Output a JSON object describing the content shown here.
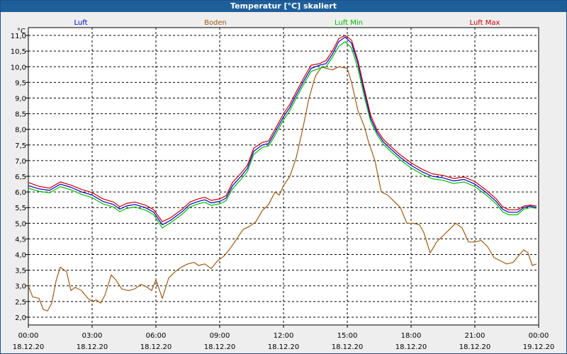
{
  "window": {
    "title": "Temperatur [°C] skaliert"
  },
  "chart_data": {
    "type": "line",
    "title": "Temperatur [°C] skaliert",
    "ylabel": "°C",
    "xlabel": "",
    "ylim": [
      1.75,
      11.25
    ],
    "xlim_hours": [
      0,
      24
    ],
    "grid": true,
    "legend_position": "top",
    "x_ticks": [
      {
        "h": 0,
        "time": "00:00",
        "date": "18.12.20"
      },
      {
        "h": 3,
        "time": "03:00",
        "date": "18.12.20"
      },
      {
        "h": 6,
        "time": "06:00",
        "date": "18.12.20"
      },
      {
        "h": 9,
        "time": "09:00",
        "date": "18.12.20"
      },
      {
        "h": 12,
        "time": "12:00",
        "date": "18.12.20"
      },
      {
        "h": 15,
        "time": "15:00",
        "date": "18.12.20"
      },
      {
        "h": 18,
        "time": "18:00",
        "date": "18.12.20"
      },
      {
        "h": 21,
        "time": "21:00",
        "date": "18.12.20"
      },
      {
        "h": 24,
        "time": "00:00",
        "date": "19.12.20"
      }
    ],
    "y_ticks": [
      "2,0",
      "2,5",
      "3,0",
      "3,5",
      "4,0",
      "4,5",
      "5,0",
      "5,5",
      "6,0",
      "6,5",
      "7,0",
      "7,5",
      "8,0",
      "8,5",
      "9,0",
      "9,5",
      "10,0",
      "10,5",
      "11,0"
    ],
    "series": [
      {
        "name": "Luft",
        "color": "#0000cc",
        "points": [
          [
            0,
            6.2
          ],
          [
            0.5,
            6.1
          ],
          [
            1,
            6.05
          ],
          [
            1.5,
            6.25
          ],
          [
            2,
            6.15
          ],
          [
            2.5,
            6.0
          ],
          [
            3,
            5.9
          ],
          [
            3.5,
            5.7
          ],
          [
            4,
            5.6
          ],
          [
            4.3,
            5.45
          ],
          [
            4.6,
            5.55
          ],
          [
            5,
            5.6
          ],
          [
            5.5,
            5.5
          ],
          [
            5.9,
            5.35
          ],
          [
            6.3,
            4.95
          ],
          [
            6.7,
            5.1
          ],
          [
            7.2,
            5.35
          ],
          [
            7.6,
            5.6
          ],
          [
            8,
            5.7
          ],
          [
            8.3,
            5.75
          ],
          [
            8.6,
            5.65
          ],
          [
            9,
            5.7
          ],
          [
            9.3,
            5.8
          ],
          [
            9.6,
            6.2
          ],
          [
            10,
            6.5
          ],
          [
            10.3,
            6.75
          ],
          [
            10.6,
            7.3
          ],
          [
            11,
            7.5
          ],
          [
            11.3,
            7.55
          ],
          [
            11.6,
            7.9
          ],
          [
            12,
            8.4
          ],
          [
            12.3,
            8.7
          ],
          [
            12.6,
            9.1
          ],
          [
            13,
            9.6
          ],
          [
            13.3,
            9.95
          ],
          [
            13.7,
            10.05
          ],
          [
            14,
            10.1
          ],
          [
            14.3,
            10.4
          ],
          [
            14.6,
            10.8
          ],
          [
            14.9,
            10.95
          ],
          [
            15.2,
            10.75
          ],
          [
            15.5,
            10.1
          ],
          [
            15.8,
            9.2
          ],
          [
            16.1,
            8.35
          ],
          [
            16.4,
            7.9
          ],
          [
            16.7,
            7.6
          ],
          [
            17,
            7.4
          ],
          [
            17.5,
            7.1
          ],
          [
            18,
            6.85
          ],
          [
            18.5,
            6.65
          ],
          [
            19,
            6.5
          ],
          [
            19.5,
            6.45
          ],
          [
            20,
            6.35
          ],
          [
            20.5,
            6.4
          ],
          [
            21,
            6.25
          ],
          [
            21.5,
            6.0
          ],
          [
            22,
            5.7
          ],
          [
            22.3,
            5.45
          ],
          [
            22.6,
            5.35
          ],
          [
            23,
            5.35
          ],
          [
            23.3,
            5.5
          ],
          [
            23.6,
            5.55
          ],
          [
            23.9,
            5.5
          ]
        ]
      },
      {
        "name": "Boden",
        "color": "#a05a14",
        "points": [
          [
            0,
            3.0
          ],
          [
            0.2,
            2.65
          ],
          [
            0.5,
            2.6
          ],
          [
            0.7,
            2.25
          ],
          [
            0.9,
            2.2
          ],
          [
            1.1,
            2.45
          ],
          [
            1.3,
            3.15
          ],
          [
            1.5,
            3.6
          ],
          [
            1.8,
            3.45
          ],
          [
            2.0,
            2.85
          ],
          [
            2.2,
            2.95
          ],
          [
            2.5,
            2.85
          ],
          [
            2.8,
            2.6
          ],
          [
            3.0,
            2.5
          ],
          [
            3.2,
            2.55
          ],
          [
            3.4,
            2.45
          ],
          [
            3.6,
            2.7
          ],
          [
            3.9,
            3.35
          ],
          [
            4.1,
            3.2
          ],
          [
            4.4,
            2.9
          ],
          [
            4.7,
            2.85
          ],
          [
            5.0,
            2.9
          ],
          [
            5.3,
            3.05
          ],
          [
            5.6,
            2.95
          ],
          [
            5.8,
            2.85
          ],
          [
            6.0,
            3.2
          ],
          [
            6.3,
            2.6
          ],
          [
            6.6,
            3.25
          ],
          [
            6.9,
            3.45
          ],
          [
            7.2,
            3.6
          ],
          [
            7.5,
            3.7
          ],
          [
            7.8,
            3.75
          ],
          [
            8.0,
            3.65
          ],
          [
            8.3,
            3.7
          ],
          [
            8.6,
            3.55
          ],
          [
            8.9,
            3.8
          ],
          [
            9.2,
            3.95
          ],
          [
            9.5,
            4.2
          ],
          [
            9.8,
            4.5
          ],
          [
            10.1,
            4.8
          ],
          [
            10.4,
            4.9
          ],
          [
            10.7,
            5.05
          ],
          [
            11.0,
            5.4
          ],
          [
            11.3,
            5.6
          ],
          [
            11.6,
            6.0
          ],
          [
            11.8,
            5.9
          ],
          [
            12.0,
            6.2
          ],
          [
            12.3,
            6.5
          ],
          [
            12.6,
            7.1
          ],
          [
            12.9,
            8.0
          ],
          [
            13.2,
            9.0
          ],
          [
            13.5,
            9.7
          ],
          [
            13.8,
            10.0
          ],
          [
            14.0,
            9.95
          ],
          [
            14.3,
            9.9
          ],
          [
            14.6,
            10.0
          ],
          [
            15.0,
            9.95
          ],
          [
            15.2,
            9.5
          ],
          [
            15.5,
            8.6
          ],
          [
            15.8,
            8.1
          ],
          [
            16.0,
            7.6
          ],
          [
            16.3,
            7.0
          ],
          [
            16.6,
            6.0
          ],
          [
            16.9,
            5.9
          ],
          [
            17.2,
            5.7
          ],
          [
            17.5,
            5.5
          ],
          [
            17.8,
            5.0
          ],
          [
            18.1,
            5.0
          ],
          [
            18.4,
            4.95
          ],
          [
            18.6,
            4.7
          ],
          [
            18.9,
            4.05
          ],
          [
            19.2,
            4.4
          ],
          [
            19.5,
            4.6
          ],
          [
            19.8,
            4.8
          ],
          [
            20.1,
            5.0
          ],
          [
            20.4,
            4.85
          ],
          [
            20.7,
            4.4
          ],
          [
            21.0,
            4.4
          ],
          [
            21.3,
            4.45
          ],
          [
            21.6,
            4.25
          ],
          [
            21.9,
            3.9
          ],
          [
            22.2,
            3.8
          ],
          [
            22.5,
            3.7
          ],
          [
            22.8,
            3.75
          ],
          [
            23.1,
            4.0
          ],
          [
            23.3,
            4.15
          ],
          [
            23.5,
            4.05
          ],
          [
            23.7,
            3.65
          ],
          [
            23.9,
            3.7
          ]
        ]
      },
      {
        "name": "Luft Min",
        "color": "#00bb00",
        "points": [
          [
            0,
            6.12
          ],
          [
            0.5,
            6.02
          ],
          [
            1,
            5.97
          ],
          [
            1.5,
            6.17
          ],
          [
            2,
            6.07
          ],
          [
            2.5,
            5.92
          ],
          [
            3,
            5.82
          ],
          [
            3.5,
            5.62
          ],
          [
            4,
            5.52
          ],
          [
            4.3,
            5.37
          ],
          [
            4.6,
            5.47
          ],
          [
            5,
            5.52
          ],
          [
            5.5,
            5.42
          ],
          [
            5.9,
            5.27
          ],
          [
            6.3,
            4.85
          ],
          [
            6.7,
            5.02
          ],
          [
            7.2,
            5.27
          ],
          [
            7.6,
            5.52
          ],
          [
            8,
            5.62
          ],
          [
            8.3,
            5.67
          ],
          [
            8.6,
            5.57
          ],
          [
            9,
            5.62
          ],
          [
            9.3,
            5.72
          ],
          [
            9.6,
            6.1
          ],
          [
            10,
            6.4
          ],
          [
            10.3,
            6.65
          ],
          [
            10.6,
            7.2
          ],
          [
            11,
            7.42
          ],
          [
            11.3,
            7.47
          ],
          [
            11.6,
            7.8
          ],
          [
            12,
            8.3
          ],
          [
            12.3,
            8.6
          ],
          [
            12.6,
            9.0
          ],
          [
            13,
            9.5
          ],
          [
            13.3,
            9.85
          ],
          [
            13.7,
            9.95
          ],
          [
            14,
            10.0
          ],
          [
            14.3,
            10.3
          ],
          [
            14.6,
            10.65
          ],
          [
            14.9,
            10.8
          ],
          [
            15.2,
            10.6
          ],
          [
            15.5,
            9.95
          ],
          [
            15.8,
            9.05
          ],
          [
            16.1,
            8.25
          ],
          [
            16.4,
            7.82
          ],
          [
            16.7,
            7.52
          ],
          [
            17,
            7.32
          ],
          [
            17.5,
            7.02
          ],
          [
            18,
            6.77
          ],
          [
            18.5,
            6.57
          ],
          [
            19,
            6.42
          ],
          [
            19.5,
            6.37
          ],
          [
            20,
            6.27
          ],
          [
            20.5,
            6.32
          ],
          [
            21,
            6.17
          ],
          [
            21.5,
            5.92
          ],
          [
            22,
            5.62
          ],
          [
            22.3,
            5.37
          ],
          [
            22.6,
            5.27
          ],
          [
            23,
            5.27
          ],
          [
            23.3,
            5.45
          ],
          [
            23.6,
            5.5
          ],
          [
            23.9,
            5.48
          ]
        ]
      },
      {
        "name": "Luft Max",
        "color": "#cc0000",
        "points": [
          [
            0,
            6.3
          ],
          [
            0.5,
            6.18
          ],
          [
            1,
            6.12
          ],
          [
            1.5,
            6.32
          ],
          [
            2,
            6.22
          ],
          [
            2.5,
            6.08
          ],
          [
            3,
            5.98
          ],
          [
            3.5,
            5.78
          ],
          [
            4,
            5.68
          ],
          [
            4.3,
            5.53
          ],
          [
            4.6,
            5.63
          ],
          [
            5,
            5.68
          ],
          [
            5.5,
            5.58
          ],
          [
            5.9,
            5.43
          ],
          [
            6.3,
            5.05
          ],
          [
            6.7,
            5.18
          ],
          [
            7.2,
            5.43
          ],
          [
            7.6,
            5.68
          ],
          [
            8,
            5.78
          ],
          [
            8.3,
            5.83
          ],
          [
            8.6,
            5.73
          ],
          [
            9,
            5.78
          ],
          [
            9.3,
            5.88
          ],
          [
            9.6,
            6.3
          ],
          [
            10,
            6.6
          ],
          [
            10.3,
            6.85
          ],
          [
            10.6,
            7.4
          ],
          [
            11,
            7.58
          ],
          [
            11.3,
            7.63
          ],
          [
            11.6,
            8.0
          ],
          [
            12,
            8.5
          ],
          [
            12.3,
            8.8
          ],
          [
            12.6,
            9.2
          ],
          [
            13,
            9.7
          ],
          [
            13.3,
            10.05
          ],
          [
            13.7,
            10.1
          ],
          [
            14,
            10.2
          ],
          [
            14.3,
            10.5
          ],
          [
            14.6,
            10.9
          ],
          [
            14.9,
            11.0
          ],
          [
            15.2,
            10.85
          ],
          [
            15.5,
            10.2
          ],
          [
            15.8,
            9.3
          ],
          [
            16.1,
            8.45
          ],
          [
            16.4,
            7.98
          ],
          [
            16.7,
            7.68
          ],
          [
            17,
            7.48
          ],
          [
            17.5,
            7.18
          ],
          [
            18,
            6.93
          ],
          [
            18.5,
            6.73
          ],
          [
            19,
            6.58
          ],
          [
            19.5,
            6.53
          ],
          [
            20,
            6.43
          ],
          [
            20.5,
            6.48
          ],
          [
            21,
            6.33
          ],
          [
            21.5,
            6.08
          ],
          [
            22,
            5.78
          ],
          [
            22.3,
            5.53
          ],
          [
            22.6,
            5.43
          ],
          [
            23,
            5.43
          ],
          [
            23.3,
            5.55
          ],
          [
            23.6,
            5.58
          ],
          [
            23.9,
            5.55
          ]
        ]
      }
    ]
  }
}
